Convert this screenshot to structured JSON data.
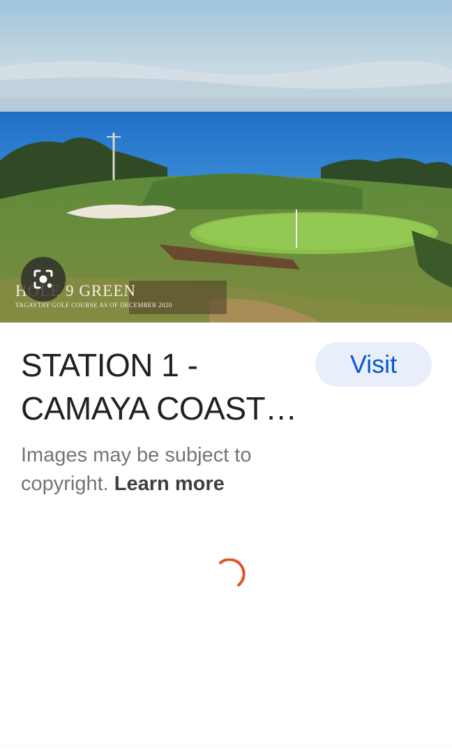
{
  "image": {
    "caption_title": "HOLE 9 GREEN",
    "caption_subtitle": "TAGAYTAY GOLF COURSE AS OF DECEMBER 2020"
  },
  "result": {
    "title_line1": "STATION 1 -",
    "title_line2": "CAMAYA COAST…",
    "visit_label": "Visit"
  },
  "notice": {
    "text": "Images may be subject to copyright.",
    "link": "Learn more"
  },
  "icons": {
    "lens": "lens-search-icon",
    "spinner": "loading-spinner-icon"
  },
  "colors": {
    "accent": "#0b57d0",
    "visit_bg": "#e8effa",
    "spinner": "#e0522a"
  }
}
